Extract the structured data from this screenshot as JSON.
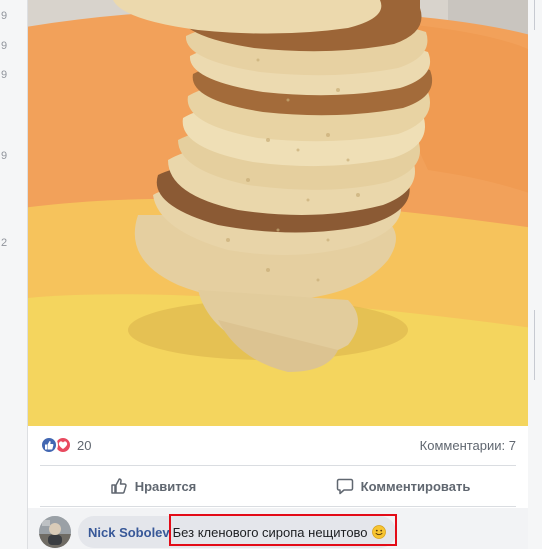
{
  "sidebar_fragment": {
    "numbers": [
      "9",
      "9",
      "9",
      "9",
      "2"
    ]
  },
  "post": {
    "photo": {
      "subject": "stack-of-pancakes-on-plate",
      "colors": {
        "plate_orange": "#f2a15a",
        "plate_yellow": "#f4d55e",
        "pancake": "#e8d4a8",
        "browned": "#8b5a34"
      }
    },
    "reactions": {
      "icons": [
        "like-icon",
        "love-icon"
      ],
      "count": "20",
      "colors": {
        "like": "#4267b2",
        "love": "#e84a5f"
      }
    },
    "comments_count_label": "Комментарии: 7",
    "actions": {
      "like_label": "Нравится",
      "comment_label": "Комментировать"
    },
    "comment": {
      "author": "Nick Sobolev",
      "text": "Без кленового сиропа нещитово",
      "emoji": "slightly-smiling-face",
      "highlight_color": "#e30b17"
    }
  }
}
